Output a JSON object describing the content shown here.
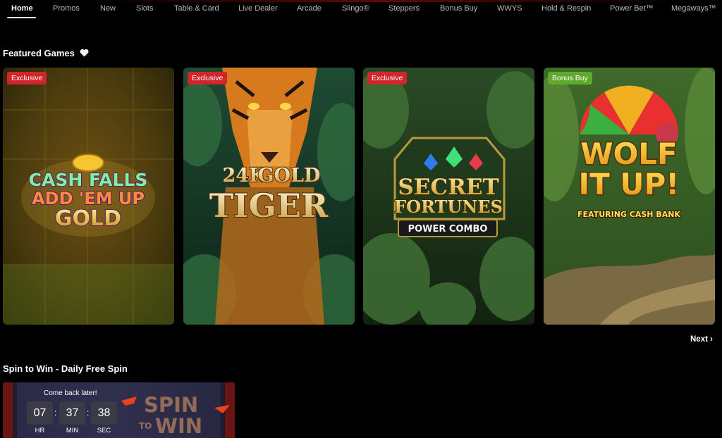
{
  "nav": {
    "tabs": [
      {
        "label": "Home",
        "active": true
      },
      {
        "label": "Promos"
      },
      {
        "label": "New"
      },
      {
        "label": "Slots"
      },
      {
        "label": "Table & Card"
      },
      {
        "label": "Live Dealer"
      },
      {
        "label": "Arcade"
      },
      {
        "label": "Slingo®"
      },
      {
        "label": "Steppers"
      },
      {
        "label": "Bonus Buy"
      },
      {
        "label": "WWYS"
      },
      {
        "label": "Hold & Respin"
      },
      {
        "label": "Power Bet™"
      },
      {
        "label": "Megaways™"
      }
    ]
  },
  "featured": {
    "title": "Featured Games",
    "title_icon": "heart-icon",
    "next_label": "Next",
    "games": [
      {
        "name": "Cash Falls Add 'Em Up Gold",
        "badge": "Exclusive",
        "badge_color": "#d0262b",
        "logo": [
          "CASH FALLS",
          "ADD 'EM UP",
          "GOLD"
        ]
      },
      {
        "name": "24K Gold Tiger",
        "badge": "Exclusive",
        "badge_color": "#d0262b",
        "logo": [
          "24K",
          "GOLD",
          "TIGER"
        ]
      },
      {
        "name": "Secret Fortunes Power Combo",
        "badge": "Exclusive",
        "badge_color": "#d0262b",
        "logo": [
          "SECRET",
          "FORTUNES",
          "POWER COMBO"
        ]
      },
      {
        "name": "Wolf It Up!",
        "badge": "Bonus Buy",
        "badge_color": "#5faa2b",
        "logo": [
          "WOLF",
          "IT UP!",
          "FEATURING CASH BANK"
        ]
      }
    ]
  },
  "spin": {
    "title": "Spin to Win - Daily Free Spin",
    "message": "Come back later!",
    "timer": {
      "hours": "07",
      "minutes": "37",
      "seconds": "38",
      "hours_label": "HR",
      "minutes_label": "MIN",
      "seconds_label": "SEC"
    },
    "logo": [
      "SPIN",
      "TO",
      "WIN"
    ]
  },
  "colors": {
    "background": "#000000",
    "exclusive_badge": "#d0262b",
    "bonus_badge": "#5faa2b",
    "timer_box": "#3a3b47"
  }
}
